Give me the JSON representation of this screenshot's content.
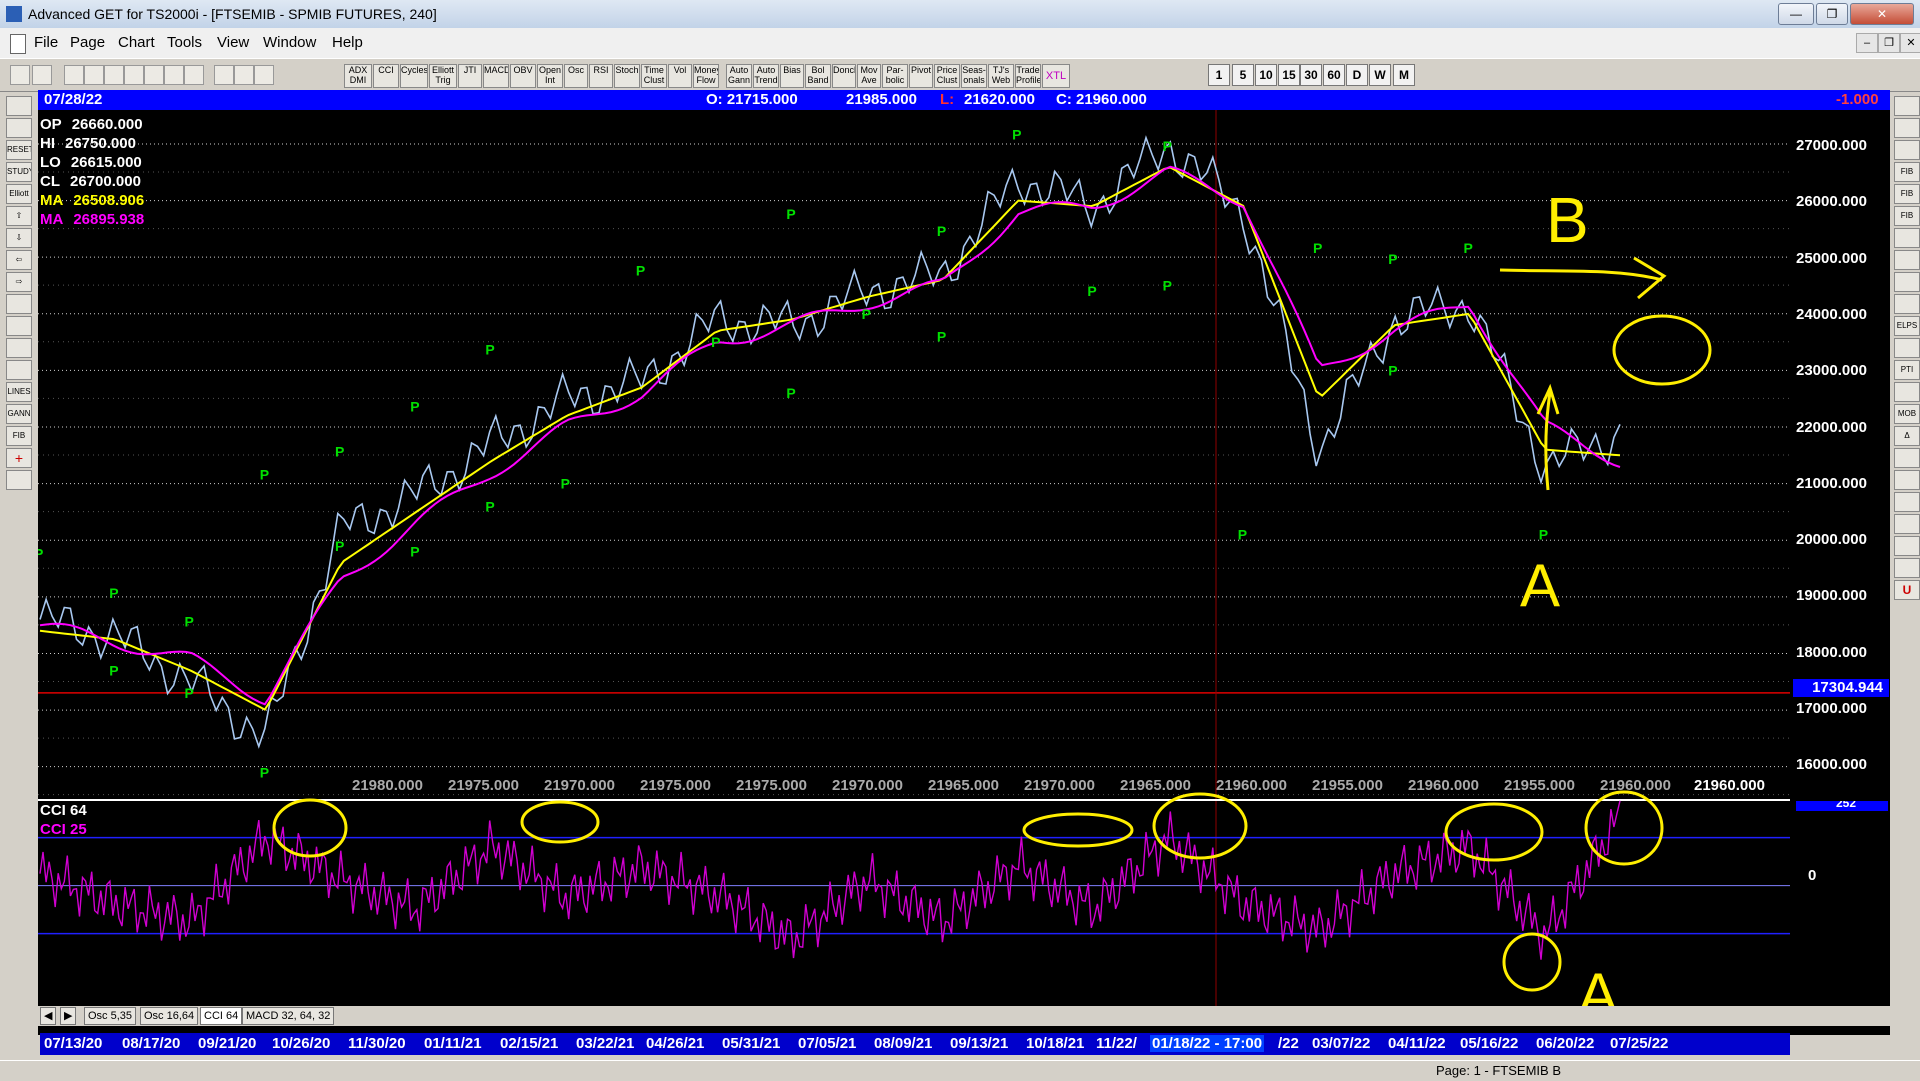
{
  "window": {
    "title": "Advanced GET for TS2000i - [FTSEMIB - SPMIB FUTURES, 240]"
  },
  "menu": [
    "File",
    "Page",
    "Chart",
    "Tools",
    "View",
    "Window",
    "Help"
  ],
  "toolbar": {
    "studies": [
      "ADX DMI",
      "CCI",
      "Cycles",
      "Elliott Trig",
      "JTI",
      "MACD",
      "OBV",
      "Open Int",
      "Osc",
      "RSI",
      "Stoch",
      "Time Clust",
      "Vol",
      "Money Flow",
      "Auto Gann",
      "Auto Trend",
      "Bias",
      "Bol Band",
      "Donch",
      "Mov Ave",
      "Par-bolic",
      "Pivot",
      "Price Clust",
      "Seas-onals",
      "TJ's Web",
      "Trade Profile",
      "XTL"
    ],
    "timeframes": [
      "1",
      "5",
      "10",
      "15",
      "30",
      "60",
      "D",
      "W",
      "M"
    ]
  },
  "side_left": [
    "RESET",
    "STUDY",
    "Elliott",
    "LINES",
    "GANN",
    "FIB"
  ],
  "side_right": [
    "FIB RET",
    "FIB EXT",
    "FIB TIME",
    "ELPS",
    "PTI",
    "MOB"
  ],
  "info": {
    "date": "07/28/22",
    "open": "O: 21715.000",
    "high": "21985.000",
    "low_label": "L:",
    "low": "21620.000",
    "close": "C: 21960.000",
    "change": "-1.000"
  },
  "ohlc_legend": [
    {
      "label": "OP",
      "value": "26660.000",
      "color": "#ffffff"
    },
    {
      "label": "HI",
      "value": "26750.000",
      "color": "#ffffff"
    },
    {
      "label": "LO",
      "value": "26615.000",
      "color": "#ffffff"
    },
    {
      "label": "CL",
      "value": "26700.000",
      "color": "#ffffff"
    },
    {
      "label": "MA",
      "value": "26508.906",
      "color": "#ffff00"
    },
    {
      "label": "MA",
      "value": "26895.938",
      "color": "#ff00ff"
    }
  ],
  "price_axis": [
    "27000.000",
    "26000.000",
    "25000.000",
    "24000.000",
    "23000.000",
    "22000.000",
    "21000.000",
    "20000.000",
    "19000.000",
    "18000.000",
    "17000.000",
    "16000.000"
  ],
  "current_price_tag": "17304.944",
  "bottom_price_labels": [
    "21980.000",
    "21975.000",
    "21970.000",
    "21975.000",
    "21975.000",
    "21970.000",
    "21965.000",
    "21970.000",
    "21965.000",
    "21960.000",
    "21955.000",
    "21960.000",
    "21955.000",
    "21960.000"
  ],
  "bottom_price_right": "21960.000",
  "annotations": {
    "b": "B",
    "a": "A"
  },
  "oscillator": {
    "label1": "CCI 64",
    "label2": "CCI  25",
    "zero": "0",
    "top_tag": "252"
  },
  "tabs": [
    "Osc 5,35",
    "Osc 16,64",
    "CCI 64",
    "MACD 32, 64, 32"
  ],
  "dates": [
    "07/13/20",
    "08/17/20",
    "09/21/20",
    "10/26/20",
    "11/30/20",
    "01/11/21",
    "02/15/21",
    "03/22/21",
    "04/26/21",
    "05/31/21",
    "07/05/21",
    "08/09/21",
    "09/13/21",
    "10/18/21",
    "11/22/",
    "01/18/22 - 17:00",
    "/22",
    "03/07/22",
    "04/11/22",
    "05/16/22",
    "06/20/22",
    "07/25/22"
  ],
  "status": "Page: 1 - FTSEMIB B",
  "chart_data": {
    "type": "line",
    "title": "FTSEMIB - SPMIB FUTURES, 240",
    "ylim": [
      15800,
      27600
    ],
    "x": [
      "07/13/20",
      "08/17/20",
      "09/21/20",
      "10/26/20",
      "11/30/20",
      "01/11/21",
      "02/15/21",
      "03/22/21",
      "04/26/21",
      "05/31/21",
      "07/05/21",
      "08/09/21",
      "09/13/21",
      "10/18/21",
      "11/22/21",
      "01/18/22",
      "02/14/22",
      "03/07/22",
      "04/11/22",
      "05/16/22",
      "06/20/22",
      "07/25/22"
    ],
    "series": [
      {
        "name": "price",
        "color": "#a8c8f0",
        "values": [
          18600,
          18300,
          17500,
          16500,
          20200,
          20800,
          21700,
          22500,
          22800,
          23900,
          23800,
          24400,
          24700,
          26400,
          25900,
          27000,
          25800,
          21600,
          23900,
          24200,
          21300,
          21900
        ]
      },
      {
        "name": "MA",
        "color": "#ffff00",
        "values": [
          18400,
          18250,
          17700,
          17000,
          19600,
          20500,
          21400,
          22200,
          22700,
          23700,
          23900,
          24300,
          24600,
          26000,
          25900,
          26600,
          25900,
          22500,
          23800,
          24000,
          21600,
          21500
        ]
      },
      {
        "name": "MA",
        "color": "#ff00ff",
        "values": [
          18500,
          18200,
          17900,
          17200,
          19300,
          20300,
          21200,
          22000,
          22600,
          23500,
          23800,
          24200,
          24500,
          25800,
          25900,
          26500,
          26000,
          23000,
          23700,
          24200,
          22000,
          21400
        ]
      }
    ],
    "pivots_high": [
      {
        "x": "07/13/20",
        "y": 19500
      },
      {
        "x": "08/17/20",
        "y": 18800
      },
      {
        "x": "09/21/20",
        "y": 18300
      },
      {
        "x": "10/26/20",
        "y": 20900
      },
      {
        "x": "11/30/20",
        "y": 21300
      },
      {
        "x": "01/11/21",
        "y": 22100
      },
      {
        "x": "02/15/21",
        "y": 23100
      },
      {
        "x": "04/26/21",
        "y": 24500
      },
      {
        "x": "07/05/21",
        "y": 25500
      },
      {
        "x": "09/13/21",
        "y": 25200
      },
      {
        "x": "10/18/21",
        "y": 26900
      },
      {
        "x": "01/18/22",
        "y": 26700
      },
      {
        "x": "03/07/22",
        "y": 24900
      },
      {
        "x": "04/11/22",
        "y": 24700
      },
      {
        "x": "05/16/22",
        "y": 24900
      }
    ],
    "pivots_low": [
      {
        "x": "08/17/20",
        "y": 18000
      },
      {
        "x": "09/21/20",
        "y": 17600
      },
      {
        "x": "10/26/20",
        "y": 16200
      },
      {
        "x": "11/30/20",
        "y": 20200
      },
      {
        "x": "01/11/21",
        "y": 20100
      },
      {
        "x": "02/15/21",
        "y": 20900
      },
      {
        "x": "03/22/21",
        "y": 21300
      },
      {
        "x": "05/31/21",
        "y": 23800
      },
      {
        "x": "07/05/21",
        "y": 22900
      },
      {
        "x": "08/09/21",
        "y": 24300
      },
      {
        "x": "09/13/21",
        "y": 23900
      },
      {
        "x": "11/22/21",
        "y": 24700
      },
      {
        "x": "01/18/22",
        "y": 24800
      },
      {
        "x": "02/14/22",
        "y": 20400
      },
      {
        "x": "04/11/22",
        "y": 23300
      },
      {
        "x": "06/20/22",
        "y": 20400
      }
    ],
    "cci": [
      40,
      -60,
      -120,
      160,
      20,
      -80,
      130,
      -40,
      60,
      -30,
      -180,
      20,
      -120,
      70,
      -80,
      160,
      -60,
      -150,
      40,
      130,
      -170,
      230
    ]
  }
}
